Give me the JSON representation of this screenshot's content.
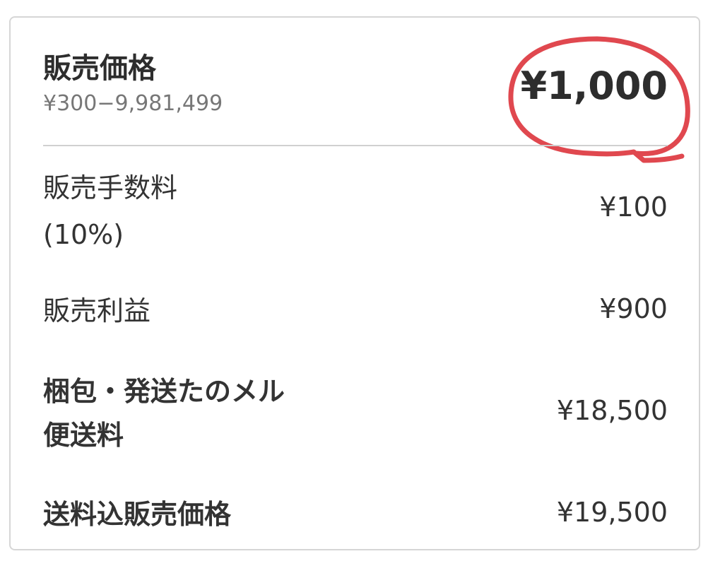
{
  "price": {
    "label": "販売価格",
    "range": "¥300−9,981,499",
    "value": "¥1,000"
  },
  "fee": {
    "label_line1": "販売手数料",
    "label_line2": "(10%)",
    "value": "¥100"
  },
  "profit": {
    "label": "販売利益",
    "value": "¥900"
  },
  "shipping": {
    "label_line1": "梱包・発送たのメル",
    "label_line2": "便送料",
    "value": "¥18,500"
  },
  "total": {
    "label": "送料込販売価格",
    "value": "¥19,500"
  },
  "colors": {
    "annotation": "#e0484f",
    "text": "#333333",
    "subtext": "#777777",
    "border": "#d6d6d6"
  }
}
